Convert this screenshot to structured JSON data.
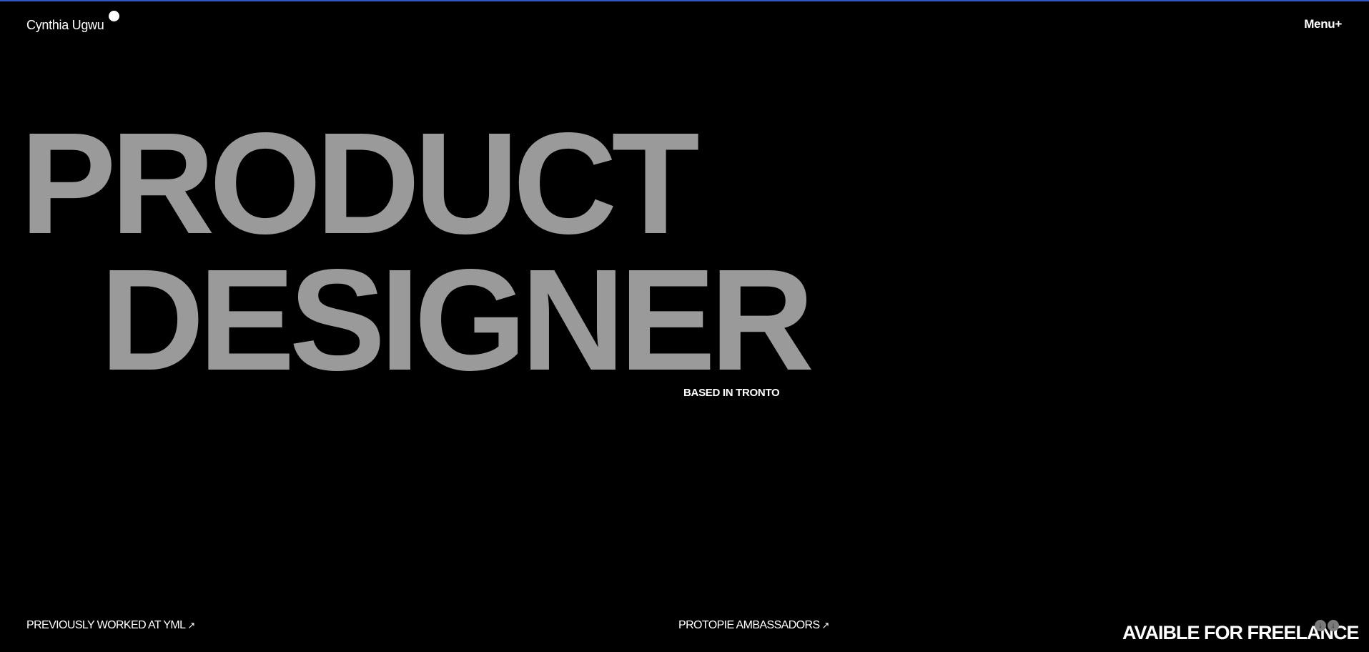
{
  "header": {
    "brand_name": "Cynthia Ugwu",
    "menu_label": "Menu+"
  },
  "hero": {
    "line1": "PRODUCT",
    "line2": "DESIGNER",
    "location": "BASED IN TRONTO"
  },
  "footer": {
    "previous_work_label": "PREVIOUSLY WORKED AT YML",
    "ambassador_label": "PROTOPIE AMBASSADORS",
    "link_arrow": "↗",
    "freelance_label": "AVAIBLE FOR FREELANCE",
    "scroll_icon_glyph": "↓"
  },
  "colors": {
    "background": "#000000",
    "hero_text": "#9a9a9a",
    "primary_text": "#ffffff",
    "top_accent": "#2f58c6"
  },
  "icons": {
    "brand_dot": "circle-dot-icon",
    "link_arrow": "arrow-up-right-icon",
    "scroll": "arrow-down-circle-icon"
  }
}
